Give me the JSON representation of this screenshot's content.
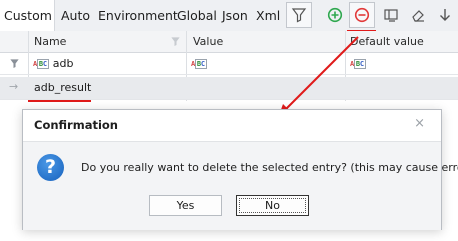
{
  "tabs": [
    "Custom",
    "Auto",
    "Environment",
    "Global",
    "Json",
    "Xml"
  ],
  "toolbar_icons": [
    "filter-icon",
    "add-icon",
    "remove-icon",
    "column-icon",
    "eraser-icon",
    "arrow-down-icon"
  ],
  "columns": {
    "name": "Name",
    "value": "Value",
    "default_value": "Default value"
  },
  "filter_row": {
    "name": "adb",
    "type_glyph": "ABC"
  },
  "selected_row": {
    "name": "adb_result"
  },
  "dialog": {
    "title": "Confirmation",
    "close_glyph": "×",
    "icon_glyph": "?",
    "message": "Do you really want to delete the selected entry? (this may cause errors)",
    "yes_label": "Yes",
    "no_label": "No"
  },
  "colors": {
    "annotation_red": "#e01b1b",
    "remove_red": "#e23a3a",
    "add_green": "#2fa84f"
  }
}
